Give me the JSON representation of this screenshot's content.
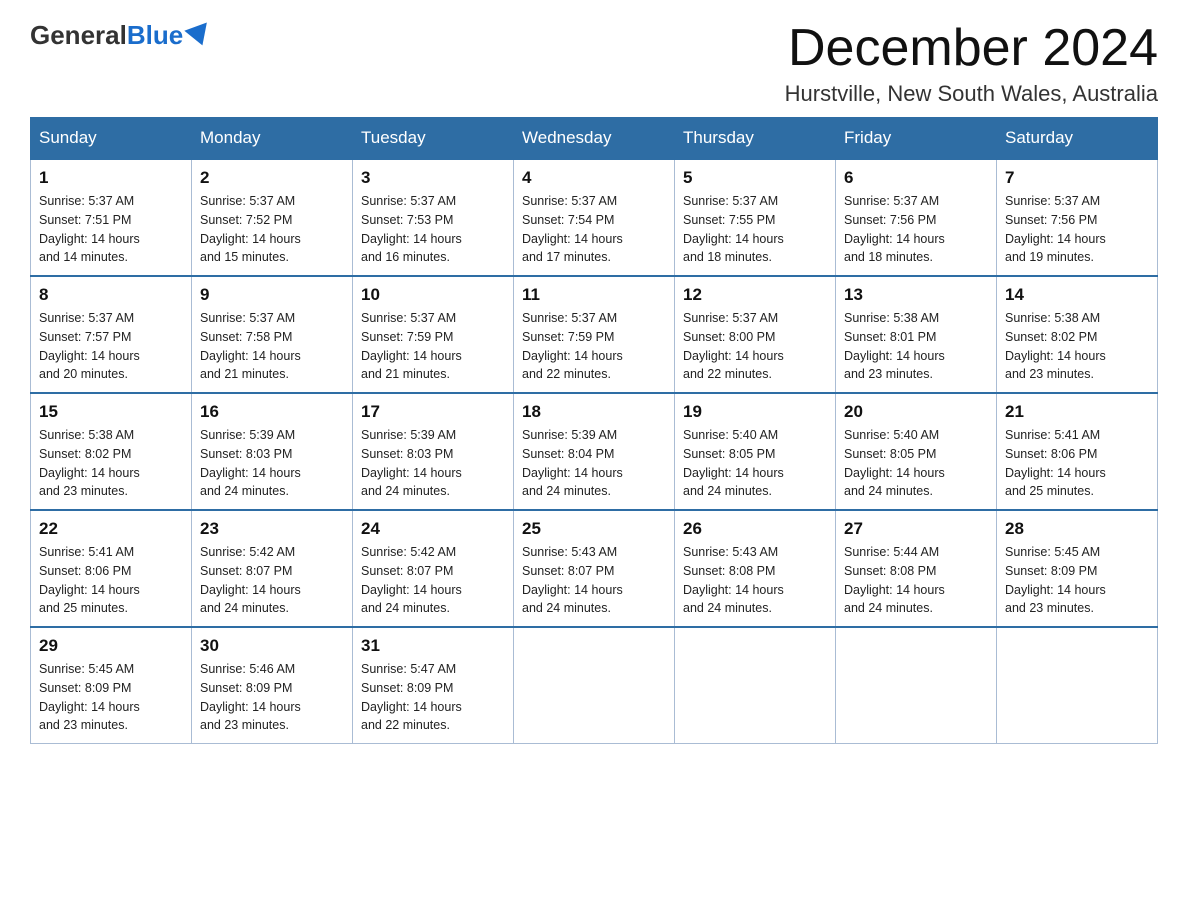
{
  "logo": {
    "general": "General",
    "blue": "Blue"
  },
  "header": {
    "month": "December 2024",
    "location": "Hurstville, New South Wales, Australia"
  },
  "weekdays": [
    "Sunday",
    "Monday",
    "Tuesday",
    "Wednesday",
    "Thursday",
    "Friday",
    "Saturday"
  ],
  "weeks": [
    [
      {
        "day": "1",
        "sunrise": "5:37 AM",
        "sunset": "7:51 PM",
        "daylight": "14 hours and 14 minutes."
      },
      {
        "day": "2",
        "sunrise": "5:37 AM",
        "sunset": "7:52 PM",
        "daylight": "14 hours and 15 minutes."
      },
      {
        "day": "3",
        "sunrise": "5:37 AM",
        "sunset": "7:53 PM",
        "daylight": "14 hours and 16 minutes."
      },
      {
        "day": "4",
        "sunrise": "5:37 AM",
        "sunset": "7:54 PM",
        "daylight": "14 hours and 17 minutes."
      },
      {
        "day": "5",
        "sunrise": "5:37 AM",
        "sunset": "7:55 PM",
        "daylight": "14 hours and 18 minutes."
      },
      {
        "day": "6",
        "sunrise": "5:37 AM",
        "sunset": "7:56 PM",
        "daylight": "14 hours and 18 minutes."
      },
      {
        "day": "7",
        "sunrise": "5:37 AM",
        "sunset": "7:56 PM",
        "daylight": "14 hours and 19 minutes."
      }
    ],
    [
      {
        "day": "8",
        "sunrise": "5:37 AM",
        "sunset": "7:57 PM",
        "daylight": "14 hours and 20 minutes."
      },
      {
        "day": "9",
        "sunrise": "5:37 AM",
        "sunset": "7:58 PM",
        "daylight": "14 hours and 21 minutes."
      },
      {
        "day": "10",
        "sunrise": "5:37 AM",
        "sunset": "7:59 PM",
        "daylight": "14 hours and 21 minutes."
      },
      {
        "day": "11",
        "sunrise": "5:37 AM",
        "sunset": "7:59 PM",
        "daylight": "14 hours and 22 minutes."
      },
      {
        "day": "12",
        "sunrise": "5:37 AM",
        "sunset": "8:00 PM",
        "daylight": "14 hours and 22 minutes."
      },
      {
        "day": "13",
        "sunrise": "5:38 AM",
        "sunset": "8:01 PM",
        "daylight": "14 hours and 23 minutes."
      },
      {
        "day": "14",
        "sunrise": "5:38 AM",
        "sunset": "8:02 PM",
        "daylight": "14 hours and 23 minutes."
      }
    ],
    [
      {
        "day": "15",
        "sunrise": "5:38 AM",
        "sunset": "8:02 PM",
        "daylight": "14 hours and 23 minutes."
      },
      {
        "day": "16",
        "sunrise": "5:39 AM",
        "sunset": "8:03 PM",
        "daylight": "14 hours and 24 minutes."
      },
      {
        "day": "17",
        "sunrise": "5:39 AM",
        "sunset": "8:03 PM",
        "daylight": "14 hours and 24 minutes."
      },
      {
        "day": "18",
        "sunrise": "5:39 AM",
        "sunset": "8:04 PM",
        "daylight": "14 hours and 24 minutes."
      },
      {
        "day": "19",
        "sunrise": "5:40 AM",
        "sunset": "8:05 PM",
        "daylight": "14 hours and 24 minutes."
      },
      {
        "day": "20",
        "sunrise": "5:40 AM",
        "sunset": "8:05 PM",
        "daylight": "14 hours and 24 minutes."
      },
      {
        "day": "21",
        "sunrise": "5:41 AM",
        "sunset": "8:06 PM",
        "daylight": "14 hours and 25 minutes."
      }
    ],
    [
      {
        "day": "22",
        "sunrise": "5:41 AM",
        "sunset": "8:06 PM",
        "daylight": "14 hours and 25 minutes."
      },
      {
        "day": "23",
        "sunrise": "5:42 AM",
        "sunset": "8:07 PM",
        "daylight": "14 hours and 24 minutes."
      },
      {
        "day": "24",
        "sunrise": "5:42 AM",
        "sunset": "8:07 PM",
        "daylight": "14 hours and 24 minutes."
      },
      {
        "day": "25",
        "sunrise": "5:43 AM",
        "sunset": "8:07 PM",
        "daylight": "14 hours and 24 minutes."
      },
      {
        "day": "26",
        "sunrise": "5:43 AM",
        "sunset": "8:08 PM",
        "daylight": "14 hours and 24 minutes."
      },
      {
        "day": "27",
        "sunrise": "5:44 AM",
        "sunset": "8:08 PM",
        "daylight": "14 hours and 24 minutes."
      },
      {
        "day": "28",
        "sunrise": "5:45 AM",
        "sunset": "8:09 PM",
        "daylight": "14 hours and 23 minutes."
      }
    ],
    [
      {
        "day": "29",
        "sunrise": "5:45 AM",
        "sunset": "8:09 PM",
        "daylight": "14 hours and 23 minutes."
      },
      {
        "day": "30",
        "sunrise": "5:46 AM",
        "sunset": "8:09 PM",
        "daylight": "14 hours and 23 minutes."
      },
      {
        "day": "31",
        "sunrise": "5:47 AM",
        "sunset": "8:09 PM",
        "daylight": "14 hours and 22 minutes."
      },
      null,
      null,
      null,
      null
    ]
  ],
  "labels": {
    "sunrise": "Sunrise:",
    "sunset": "Sunset:",
    "daylight": "Daylight:"
  }
}
